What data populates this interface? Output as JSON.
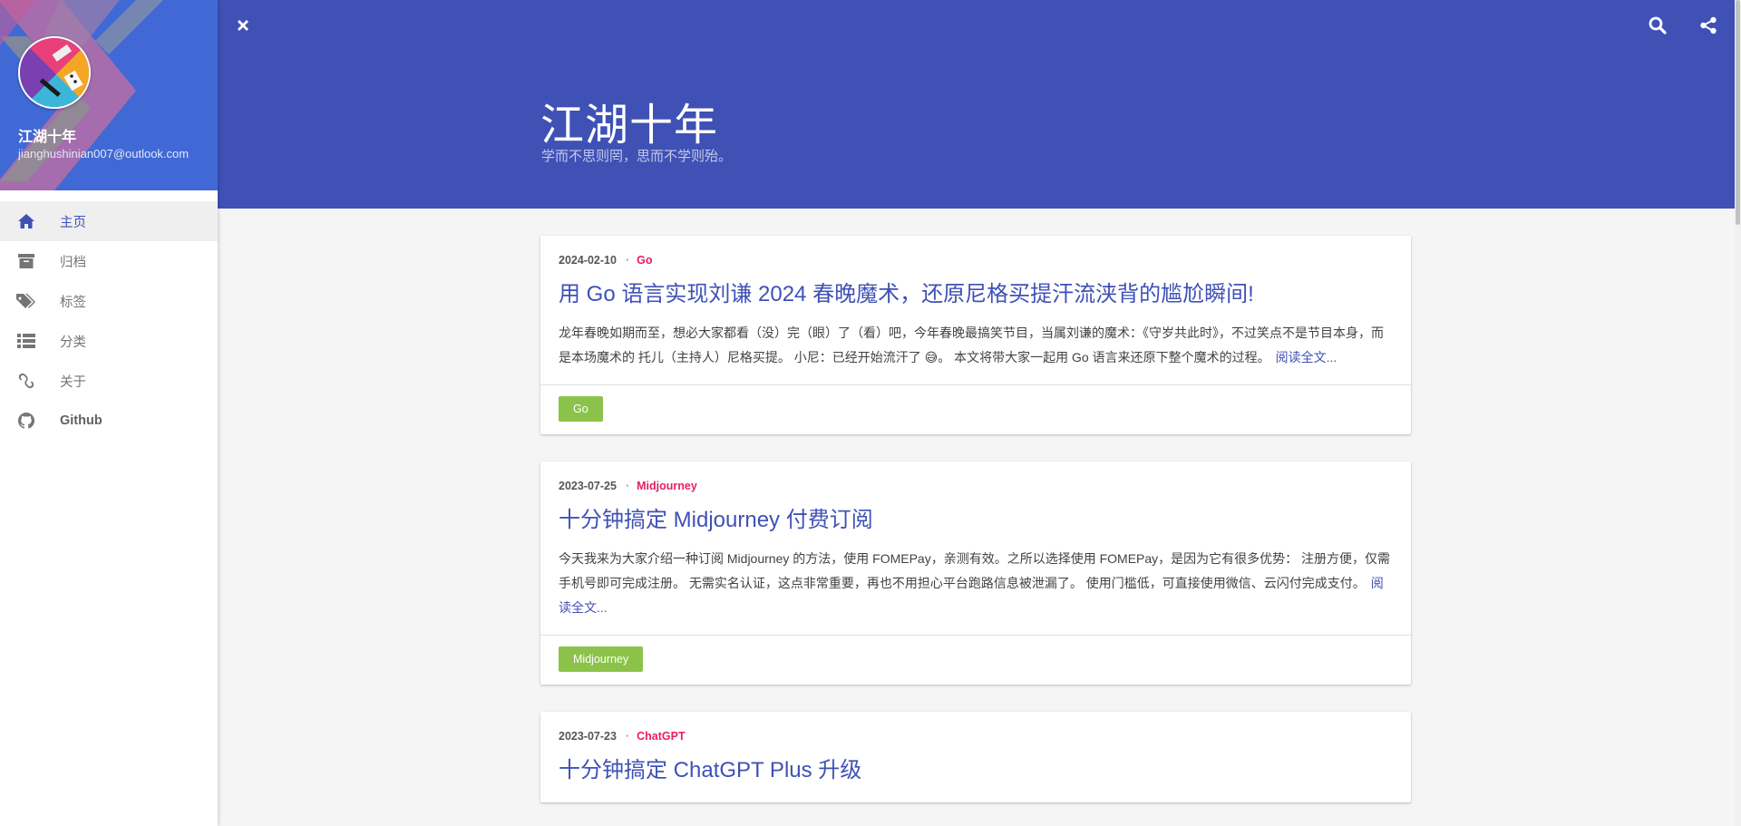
{
  "profile": {
    "name": "江湖十年",
    "email": "jianghushinian007@outlook.com"
  },
  "nav": {
    "items": [
      {
        "label": "主页",
        "icon": "home-icon"
      },
      {
        "label": "归档",
        "icon": "archive-icon"
      },
      {
        "label": "标签",
        "icon": "tags-icon"
      },
      {
        "label": "分类",
        "icon": "list-icon"
      },
      {
        "label": "关于",
        "icon": "link-icon"
      },
      {
        "label": "Github",
        "icon": "github-icon"
      }
    ]
  },
  "header": {
    "title": "江湖十年",
    "subtitle": "学而不思则罔，思而不学则殆。"
  },
  "posts": [
    {
      "date": "2024-02-10",
      "category": "Go",
      "title": "用 Go 语言实现刘谦 2024 春晚魔术，还原尼格买提汗流浃背的尴尬瞬间!",
      "excerpt": "龙年春晚如期而至，想必大家都看（没）完（眼）了（看）吧，今年春晚最搞笑节目，当属刘谦的魔术：《守岁共此时》，不过笑点不是节目本身，而是本场魔术的 托儿（主持人）尼格买提。 小尼：已经开始流汗了 😅。 本文将带大家一起用 Go 语言来还原下整个魔术的过程。",
      "read_more": "阅读全文...",
      "tag": "Go"
    },
    {
      "date": "2023-07-25",
      "category": "Midjourney",
      "title": "十分钟搞定 Midjourney 付费订阅",
      "excerpt": "今天我来为大家介绍一种订阅 Midjourney 的方法，使用 FOMEPay，亲测有效。之所以选择使用 FOMEPay，是因为它有很多优势： 注册方便，仅需手机号即可完成注册。 无需实名认证，这点非常重要，再也不用担心平台跑路信息被泄漏了。 使用门槛低，可直接使用微信、云闪付完成支付。",
      "read_more": "阅读全文...",
      "tag": "Midjourney"
    },
    {
      "date": "2023-07-23",
      "category": "ChatGPT",
      "title": "十分钟搞定 ChatGPT Plus 升级"
    }
  ],
  "colors": {
    "primary": "#3f51b5",
    "accent": "#e91e63",
    "tag": "#8bc34a",
    "sidebar_header": "#4169d6"
  }
}
